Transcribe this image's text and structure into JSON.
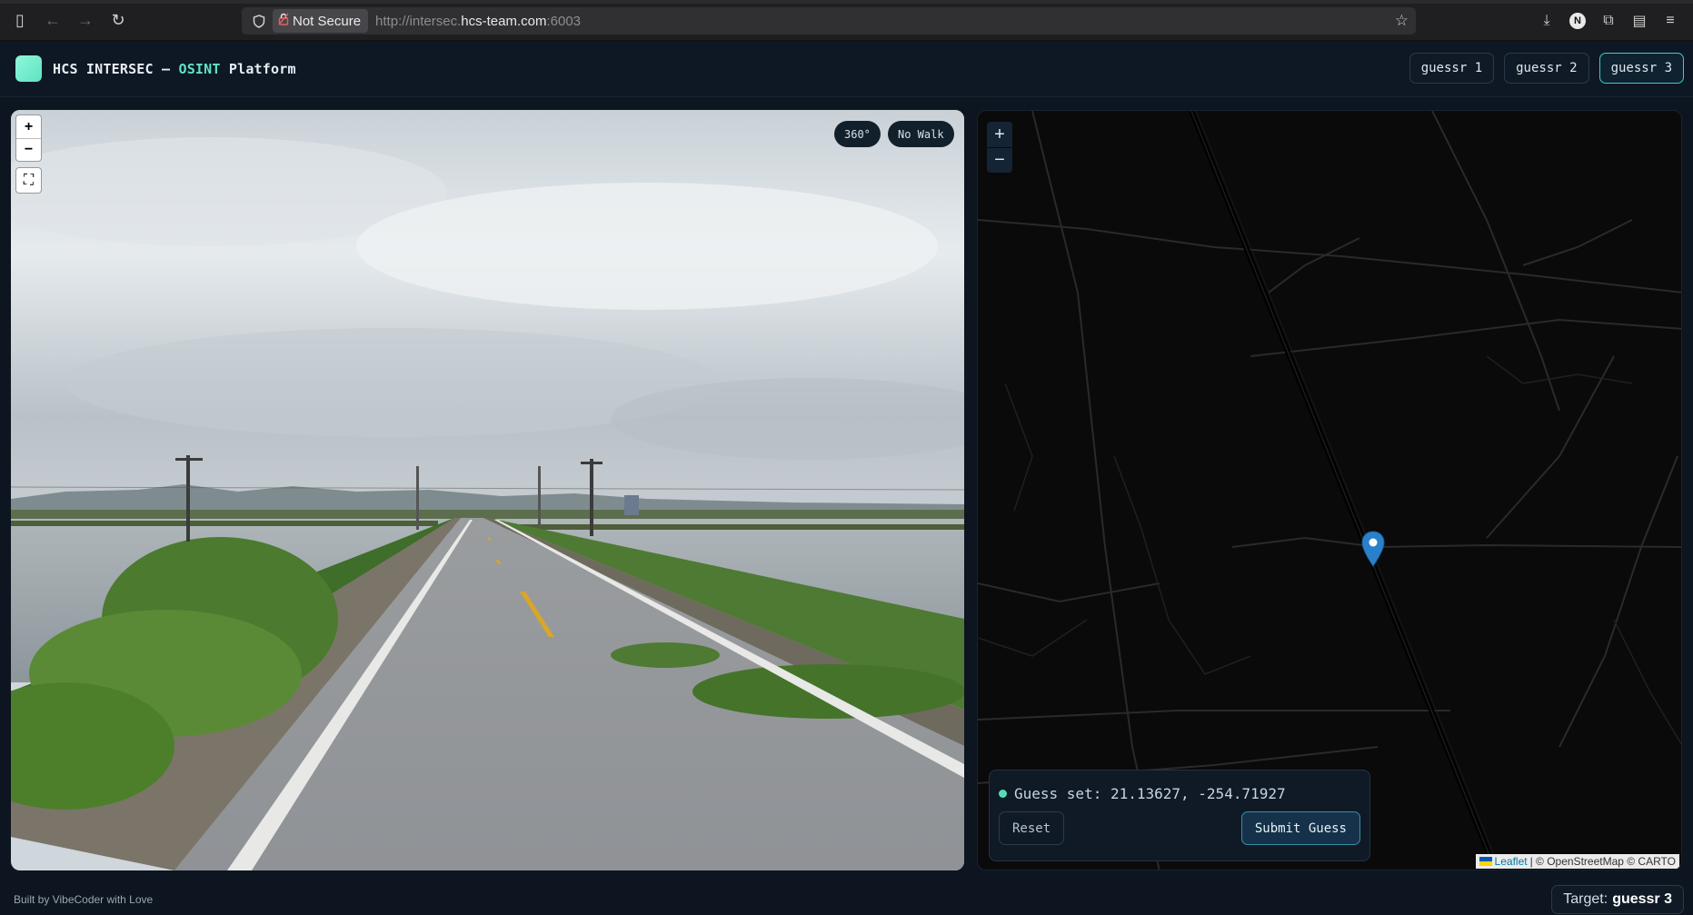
{
  "browser": {
    "not_secure_label": "Not Secure",
    "url_prefix": "http://intersec.",
    "url_host": "hcs-team.com",
    "url_port": ":6003",
    "profile_initial": "N"
  },
  "header": {
    "title_prefix": "HCS INTERSEC — ",
    "title_accent": "OSINT",
    "title_suffix": " Platform",
    "tabs": [
      {
        "label": "guessr 1",
        "active": false
      },
      {
        "label": "guessr 2",
        "active": false
      },
      {
        "label": "guessr 3",
        "active": true
      }
    ]
  },
  "street_view": {
    "zoom_in": "+",
    "zoom_out": "−",
    "pill_360": "360°",
    "pill_walk": "No Walk"
  },
  "map": {
    "zoom_in": "+",
    "zoom_out": "−",
    "guess_label": "Guess set: 21.13627, -254.71927",
    "reset_label": "Reset",
    "submit_label": "Submit Guess",
    "attribution_leaflet": "Leaflet",
    "attribution_rest": "| © OpenStreetMap © CARTO",
    "marker_color": "#2a81cb"
  },
  "footer": {
    "credit": "Built by VibeCoder with Love",
    "target_label": "Target:",
    "target_value": "guessr 3"
  },
  "colors": {
    "accent": "#5fe3c8",
    "background": "#0d1520",
    "active_tab_border": "#47c9c7"
  }
}
